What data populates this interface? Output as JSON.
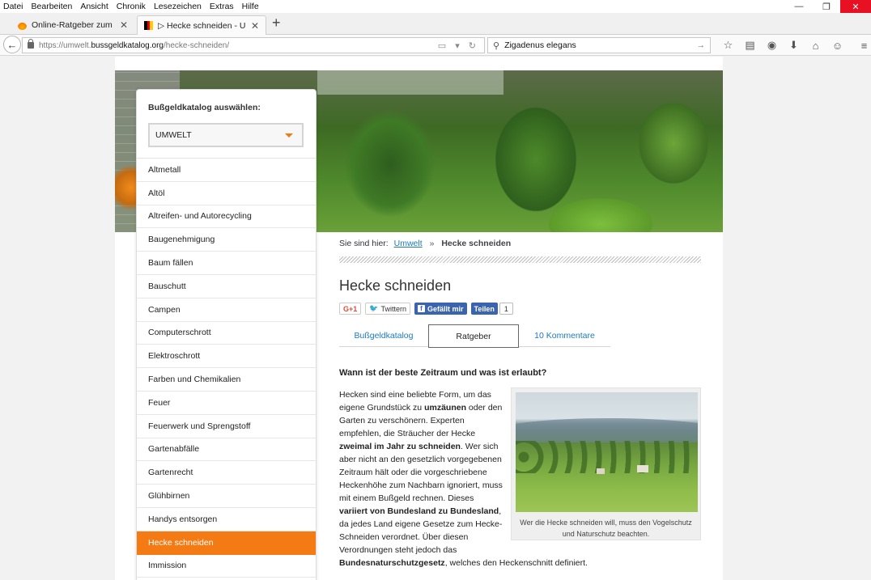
{
  "menubar": {
    "items": [
      "Datei",
      "Bearbeiten",
      "Ansicht",
      "Chronik",
      "Lesezeichen",
      "Extras",
      "Hilfe"
    ]
  },
  "window_controls": {
    "minimize": "—",
    "restore": "❐",
    "close": "✕"
  },
  "tabs": [
    {
      "title": "Online-Ratgeber zum Gart...",
      "close": "✕"
    },
    {
      "title": "▷ Hecke schneiden - Um...",
      "close": "✕"
    }
  ],
  "new_tab_glyph": "+",
  "navbar": {
    "back_glyph": "←",
    "url_prefix": "https://umwelt.",
    "url_host": "bussgeldkatalog.org",
    "url_path": "/hecke-schneiden/",
    "url_icons": "▭ ▾ ↻",
    "search_icon": "⚲",
    "search_value": "Zigadenus elegans",
    "search_go": "→",
    "toolbar_icons": [
      "☆",
      "▤",
      "◉",
      "⬇",
      "⌂",
      "☺"
    ],
    "menu_glyph": "≡"
  },
  "sidebar": {
    "title": "Bußgeldkatalog auswählen:",
    "selected_catalog": "UMWELT",
    "items": [
      {
        "label": "Altmetall"
      },
      {
        "label": "Altöl"
      },
      {
        "label": "Altreifen- und Autorecycling"
      },
      {
        "label": "Baugenehmigung"
      },
      {
        "label": "Baum fällen"
      },
      {
        "label": "Bauschutt"
      },
      {
        "label": "Campen"
      },
      {
        "label": "Computerschrott"
      },
      {
        "label": "Elektroschrott"
      },
      {
        "label": "Farben und Chemikalien"
      },
      {
        "label": "Feuer"
      },
      {
        "label": "Feuerwerk und Sprengstoff"
      },
      {
        "label": "Gartenabfälle"
      },
      {
        "label": "Gartenrecht"
      },
      {
        "label": "Glühbirnen"
      },
      {
        "label": "Handys entsorgen"
      },
      {
        "label": "Hecke schneiden",
        "active": true
      },
      {
        "label": "Immission"
      }
    ]
  },
  "breadcrumb": {
    "prefix": "Sie sind hier:",
    "link": "Umwelt",
    "separator": "»",
    "current": "Hecke schneiden"
  },
  "page_title": "Hecke schneiden",
  "social": {
    "gplus": "G+1",
    "twitter_icon": "🐦",
    "twitter": "Twittern",
    "fb_icon": "f",
    "facebook": "Gefällt mir",
    "share": "Teilen",
    "count": "1"
  },
  "content_tabs": [
    "Bußgeldkatalog",
    "Ratgeber",
    "10 Kommentare"
  ],
  "section_heading": "Wann ist der beste Zeitraum und was ist erlaubt?",
  "article": {
    "p1": "Hecken sind eine beliebte Form, um das eigene Grundstück zu ",
    "b1": "umzäunen",
    "p2": " oder den Garten zu verschönern. Experten empfehlen, die Sträucher der Hecke ",
    "b2": "zweimal im Jahr zu schneiden",
    "p3": ". Wer sich aber nicht an den gesetzlich vorgegebenen Zeitraum hält oder die vorgeschriebene Heckenhöhe zum Nachbarn ignoriert, muss mit einem Bußgeld rechnen. Dieses ",
    "b3": "variiert von Bundesland zu Bundesland",
    "p4": ", da jedes Land eigene Gesetze zum Hecke-Schneiden verordnet. Über diesen Verordnungen steht jedoch das",
    "b4": "Bundesnaturschutzgesetz",
    "p5": ", welches den Heckenschnitt definiert."
  },
  "figure": {
    "caption": "Wer die Hecke schneiden will, muss den Vogelschutz und Naturschutz beachten."
  },
  "colors": {
    "accent_orange": "#f47b13",
    "link_blue": "#1c7abf",
    "facebook_blue": "#3a64ad",
    "close_red": "#e81123"
  }
}
